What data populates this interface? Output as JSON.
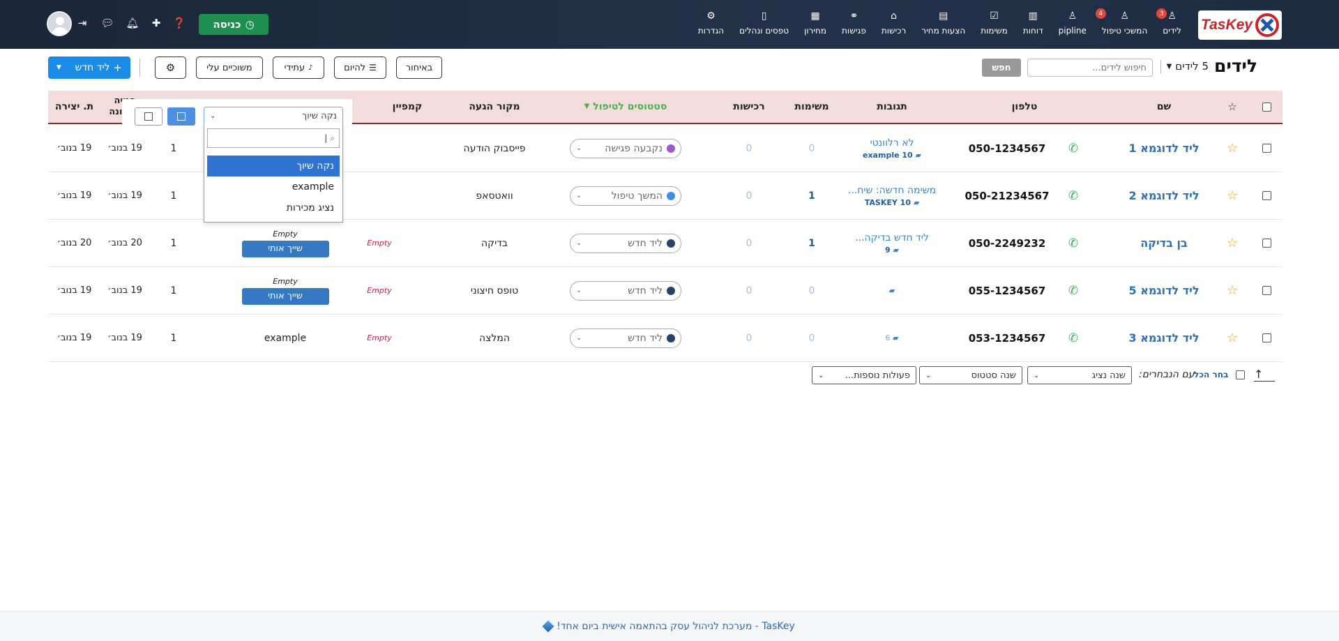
{
  "brand": {
    "logo_text": "TasKey"
  },
  "nav": [
    {
      "label": "לידים",
      "icon": "user-icon",
      "glyph": "♙",
      "badge": "3"
    },
    {
      "label": "המשכי טיפול",
      "icon": "user-icon",
      "glyph": "♙",
      "badge": "4"
    },
    {
      "label": "pipline",
      "icon": "user-icon",
      "glyph": "♙",
      "badge": ""
    },
    {
      "label": "דוחות",
      "icon": "chart-icon",
      "glyph": "▥",
      "badge": ""
    },
    {
      "label": "משימות",
      "icon": "checkbox-icon",
      "glyph": "☑",
      "badge": ""
    },
    {
      "label": "הצעות מחיר",
      "icon": "document-icon",
      "glyph": "▤",
      "badge": ""
    },
    {
      "label": "רכישות",
      "icon": "factory-icon",
      "glyph": "⌂",
      "badge": ""
    },
    {
      "label": "פגישות",
      "icon": "handshake-icon",
      "glyph": "⚭",
      "badge": ""
    },
    {
      "label": "מחירון",
      "icon": "barcode-icon",
      "glyph": "▦",
      "badge": ""
    },
    {
      "label": "טפסים ונהלים",
      "icon": "book-icon",
      "glyph": "▯",
      "badge": ""
    },
    {
      "label": "הגדרות",
      "icon": "gear-icon",
      "glyph": "⚙",
      "badge": ""
    }
  ],
  "clockin": {
    "label": "כניסה"
  },
  "page": {
    "title": "לידים",
    "count": "5 לידים"
  },
  "search": {
    "placeholder": "חיפוש לידים...",
    "button": "חפש"
  },
  "toolbar": {
    "late": "באיחור",
    "today": "להיום",
    "future": "עתידי",
    "mine": "משוכיים עלי",
    "new_lead": "ליד חדש"
  },
  "columns": {
    "name": "שם",
    "phone": "טלפון",
    "responses": "תגובות",
    "tasks": "משימות",
    "purchases": "רכישות",
    "status": "סטטוסים לטיפול",
    "source": "מקור הגעה",
    "campaign": "קמפיין",
    "last_update": "פנייה אחרונה",
    "created": "ת. יצירה"
  },
  "rows": [
    {
      "name": "ליד לדוגמא 1",
      "phone": "050-1234567",
      "resp_text": "לא רלוונטי",
      "resp_meta": "10 example",
      "tasks": "0",
      "purchases": "0",
      "status": "נקבעה פגישה",
      "status_color": "#9b59c9",
      "source": "פייסבוק הודעה",
      "campaign": "",
      "assign_empty": "",
      "assign_btn": "",
      "assign_value": "",
      "count": "1",
      "last": "19 בנוב׳",
      "created": "19 בנוב׳"
    },
    {
      "name": "ליד לדוגמא 2",
      "phone": "050-21234567",
      "resp_text": "משימה חדשה: שיח...",
      "resp_meta": "10 TASKEY",
      "tasks": "1",
      "purchases": "0",
      "status": "המשך טיפול",
      "status_color": "#3a8ee8",
      "source": "וואטסאפ",
      "campaign": "",
      "assign_empty": "",
      "assign_btn": "",
      "assign_value": "",
      "count": "1",
      "last": "19 בנוב׳",
      "created": "19 בנוב׳"
    },
    {
      "name": "בן בדיקה",
      "phone": "050-2249232",
      "resp_text": "ליד חדש בדיקה...",
      "resp_meta": "9",
      "tasks": "1",
      "purchases": "0",
      "status": "ליד חדש",
      "status_color": "#25406a",
      "source": "בדיקה",
      "campaign": "Empty",
      "assign_empty": "Empty",
      "assign_btn": "שייך אותי",
      "assign_value": "",
      "count": "1",
      "last": "20 בנוב׳",
      "created": "20 בנוב׳"
    },
    {
      "name": "ליד לדוגמא 5",
      "phone": "055-1234567",
      "resp_text": "",
      "resp_meta": "",
      "tasks": "0",
      "purchases": "0",
      "status": "ליד חדש",
      "status_color": "#25406a",
      "source": "טופס חיצוני",
      "campaign": "Empty",
      "assign_empty": "Empty",
      "assign_btn": "שייך אותי",
      "assign_value": "",
      "count": "1",
      "last": "19 בנוב׳",
      "created": "19 בנוב׳"
    },
    {
      "name": "ליד לדוגמא 3",
      "phone": "053-1234567",
      "resp_text": "",
      "resp_meta": "6",
      "tasks": "0",
      "purchases": "0",
      "status": "ליד חדש",
      "status_color": "#25406a",
      "source": "המלצה",
      "campaign": "Empty",
      "assign_empty": "",
      "assign_btn": "",
      "assign_value": "example",
      "count": "1",
      "last": "19 בנוב׳",
      "created": "19 בנוב׳"
    }
  ],
  "assign_dropdown": {
    "selected": "נקה שיוך",
    "options": [
      "נקה שיוך",
      "example",
      "נציג מכירות"
    ]
  },
  "bulk": {
    "select_all": "בחר הכל",
    "with_selected": "עם הנבחרים:",
    "change_agent": "שנה נציג",
    "change_status": "שנה סטטוס",
    "more_actions": "פעולות נוספות..."
  },
  "footer": {
    "text": "TasKey - מערכת לניהול עסק בהתאמה אישית ביום אחד!"
  },
  "colors": {
    "topbar": "#1d2c42",
    "primary": "#1b8be8",
    "clockin": "#1e8f4e",
    "header_row": "#f3dcdc",
    "link": "#2d72b8"
  }
}
